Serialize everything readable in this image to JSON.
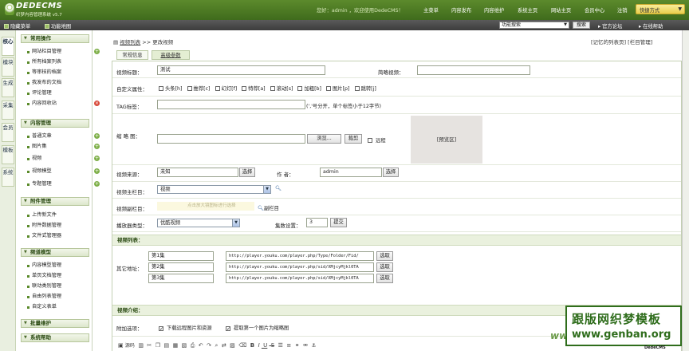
{
  "header": {
    "logo_main": "DEDECMS",
    "logo_sub": "织梦内容管理系统 v5.7",
    "user_greeting": "您好：admin ，欢迎使用DedeCMS！",
    "nav": [
      "主菜单",
      "内容发布",
      "内容维护",
      "系统主页",
      "网站主页",
      "会员中心",
      "注销"
    ],
    "quick_label": "快捷方式"
  },
  "subbar": {
    "hide_menu": "隐藏菜单",
    "func_map": "功能地图",
    "func_search_value": "功能搜索",
    "search_button": "搜索",
    "forum": "官方论坛",
    "help": "在线帮助"
  },
  "left_tabs": [
    "核心",
    "模块",
    "生成",
    "采集",
    "会员",
    "模板",
    "系统"
  ],
  "menu": {
    "sections": [
      {
        "title": "常用操作",
        "items": [
          "网站栏目管理",
          "所有档案列表",
          "等审核的档案",
          "我发布的文档",
          "评论管理",
          "内容回收站"
        ]
      },
      {
        "title": "内容管理",
        "items": [
          "普通文章",
          "图片集",
          "视频",
          "视频模型",
          "专题管理"
        ]
      },
      {
        "title": "附件管理",
        "items": [
          "上传新文件",
          "附件数据管理",
          "文件式管理器"
        ]
      },
      {
        "title": "频道模型",
        "items": [
          "内容模型管理",
          "单页文档管理",
          "联动类别管理",
          "自由列表管理",
          "自定义表单"
        ]
      },
      {
        "title": "批量维护",
        "items": []
      },
      {
        "title": "系统帮助",
        "items": []
      }
    ]
  },
  "breadcrumb": {
    "link": "视频列表",
    "sep": ">>",
    "current": "更改视频",
    "right_links": [
      "[记忆的列表页]",
      "[栏目管理]"
    ]
  },
  "tabs": [
    "常规信息",
    "高级参数"
  ],
  "form": {
    "title_label": "视频标题：",
    "title_value": "测试",
    "short_title_label": "简略视频：",
    "short_title_value": "",
    "attr_label": "自定义属性：",
    "attrs": [
      "头条[h]",
      "推荐[c]",
      "幻灯[f]",
      "特荐[a]",
      "滚动[s]",
      "加粗[b]",
      "图片[p]",
      "跳转[j]"
    ],
    "tag_label": "TAG标签：",
    "tag_value": "",
    "tag_hint": "(','号分开，单个标签小于12字节)",
    "thumb_label": "缩 略 图：",
    "thumb_value": "",
    "browse_button": "浏览...",
    "crop_button": "裁剪",
    "remote_label": "远程",
    "preview_label": "[预览区]",
    "source_label": "视频来源：",
    "source_value": "未知",
    "source_button": "选择",
    "author_label": "作  者：",
    "author_value": "admin",
    "author_button": "选择",
    "main_cat_label": "视频主栏目：",
    "main_cat_value": "视频",
    "sub_cat_label": "视频副栏目：",
    "sub_cat_hint": "点击放大镜图标进行选择",
    "sub_cat_link": "副栏目",
    "player_label": "播放器类型：",
    "player_value": "优酷视频",
    "count_label": "集数设置：",
    "count_value": "3",
    "count_button": "提交",
    "list_section": "视频列表：",
    "other_label": "其它地址：",
    "episodes": [
      {
        "name": "第1集",
        "url": "http://player.youku.com/player.php/Type/Folder/Fid/",
        "button": "选取"
      },
      {
        "name": "第2集",
        "url": "http://player.youku.com/player.php/sid/XMjcyMjkl0TA",
        "button": "选取"
      },
      {
        "name": "第3集",
        "url": "http://player.youku.com/player.php/sid/XMjcyMjkl0TA",
        "button": "选取"
      }
    ],
    "intro_section": "视频介绍：",
    "options_label": "附加选项：",
    "option_download": "下载远程图片和资源",
    "option_extract": "提取第一个图片为缩略图",
    "editor_source": "源码"
  },
  "watermark": {
    "line1": "跟版网织梦模板",
    "line2": "www.genban.org",
    "ghost": "ww",
    "ghost2": "DedeCMS"
  }
}
